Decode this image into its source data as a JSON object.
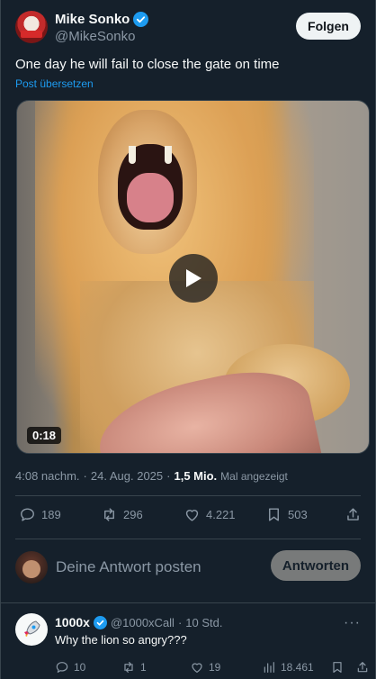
{
  "author": {
    "display_name": "Mike Sonko",
    "handle": "@MikeSonko",
    "follow_label": "Folgen"
  },
  "tweet": {
    "text": "One day he will fail to close the gate on time",
    "translate_label": "Post übersetzen",
    "video_duration": "0:18",
    "time": "4:08 nachm.",
    "date": "24. Aug. 2025",
    "views": "1,5 Mio.",
    "views_label": "Mal angezeigt"
  },
  "actions": {
    "replies": "189",
    "reposts": "296",
    "likes": "4.221",
    "bookmarks": "503"
  },
  "compose": {
    "placeholder": "Deine Antwort posten",
    "reply_button": "Antworten"
  },
  "reply": {
    "display_name": "1000x",
    "handle": "@1000xCall",
    "time": "10 Std.",
    "text": "Why the lion so angry???",
    "replies": "10",
    "reposts": "1",
    "likes": "19",
    "views": "18.461"
  },
  "colors": {
    "background": "#15202b",
    "accent": "#1d9bf0",
    "muted_text": "#8b98a5",
    "divider": "#38444d"
  }
}
